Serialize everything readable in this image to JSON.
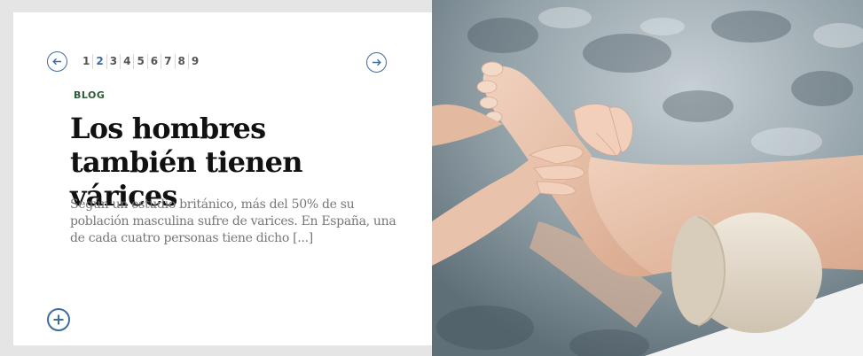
{
  "pagination": {
    "prev_icon": "arrow-left-icon",
    "next_icon": "arrow-right-icon",
    "pages": [
      "1",
      "2",
      "3",
      "4",
      "5",
      "6",
      "7",
      "8",
      "9"
    ],
    "active_page": "2"
  },
  "article": {
    "category": "BLOG",
    "title": "Los hombres también tienen várices",
    "excerpt": "Según un estudio británico, más del 50% de su población masculina sufre de varices. En España, una de cada cuatro personas tiene dicho [...]",
    "more_icon": "plus-icon"
  },
  "image": {
    "subject": "foot-massage-photo"
  },
  "colors": {
    "accent": "#3d6c9e",
    "category": "#2f5c3a",
    "title": "#111111",
    "excerpt": "#777777",
    "background": "#e6e5e5",
    "card": "#ffffff"
  }
}
